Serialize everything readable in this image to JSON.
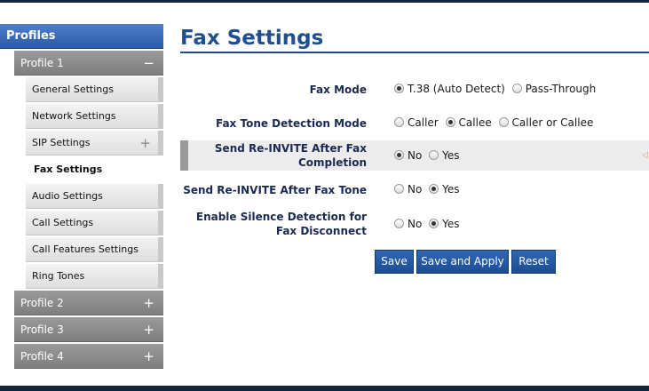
{
  "sidebar": {
    "header": "Profiles",
    "profile1": {
      "label": "Profile 1",
      "sign": "−"
    },
    "sub_items": [
      {
        "label": "General Settings"
      },
      {
        "label": "Network Settings"
      },
      {
        "label": "SIP Settings",
        "sign": "+"
      },
      {
        "label": "Fax Settings",
        "active": true
      },
      {
        "label": "Audio Settings"
      },
      {
        "label": "Call Settings"
      },
      {
        "label": "Call Features Settings"
      },
      {
        "label": "Ring Tones"
      }
    ],
    "other_profiles": [
      {
        "label": "Profile 2",
        "sign": "+"
      },
      {
        "label": "Profile 3",
        "sign": "+"
      },
      {
        "label": "Profile 4",
        "sign": "+"
      }
    ]
  },
  "main": {
    "title": "Fax Settings",
    "settings": [
      {
        "label": "Fax Mode",
        "options": [
          {
            "label": "T.38 (Auto Detect)",
            "checked": true
          },
          {
            "label": "Pass-Through",
            "checked": false
          }
        ]
      },
      {
        "label": "Fax Tone Detection Mode",
        "options": [
          {
            "label": "Caller",
            "checked": false
          },
          {
            "label": "Callee",
            "checked": true
          },
          {
            "label": "Caller or Callee",
            "checked": false
          }
        ]
      },
      {
        "label_line1": "Send Re-INVITE After Fax",
        "label_line2": "Completion",
        "options": [
          {
            "label": "No",
            "checked": true
          },
          {
            "label": "Yes",
            "checked": false
          }
        ]
      },
      {
        "label": "Send Re-INVITE After Fax Tone",
        "options": [
          {
            "label": "No",
            "checked": false
          },
          {
            "label": "Yes",
            "checked": true
          }
        ]
      },
      {
        "label_line1": "Enable Silence Detection for",
        "label_line2": "Fax Disconnect",
        "options": [
          {
            "label": "No",
            "checked": false
          },
          {
            "label": "Yes",
            "checked": true
          }
        ]
      }
    ],
    "buttons": {
      "save": "Save",
      "save_apply": "Save and Apply",
      "reset": "Reset"
    }
  },
  "colors": {
    "accent": "#1f4f8f",
    "header_blue": "#2a5aa8",
    "button_blue": "#1d4d93",
    "frame": "#14253a"
  }
}
